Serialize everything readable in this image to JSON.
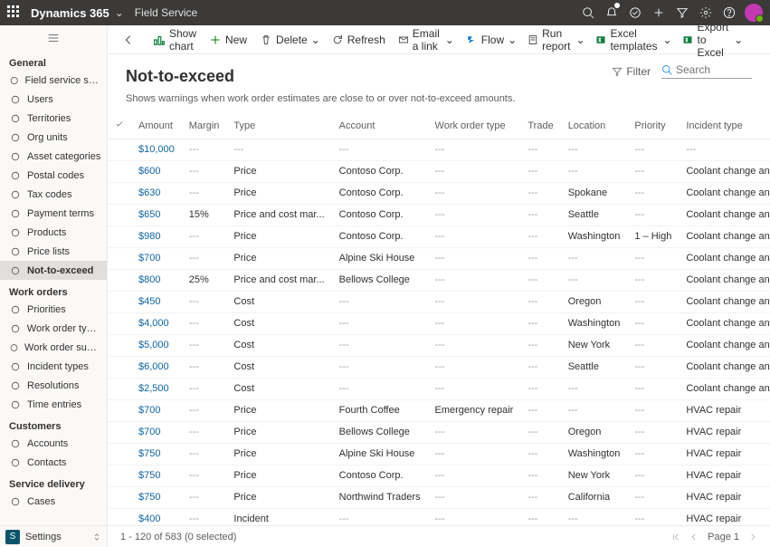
{
  "topbar": {
    "brand": "Dynamics 365",
    "area": "Field Service"
  },
  "sidebar": {
    "sections": [
      {
        "title": "General",
        "items": [
          {
            "label": "Field service settings",
            "icon": "gear",
            "key": "fss"
          },
          {
            "label": "Users",
            "icon": "user",
            "key": "users"
          },
          {
            "label": "Territories",
            "icon": "globe",
            "key": "terr"
          },
          {
            "label": "Org units",
            "icon": "org",
            "key": "org"
          },
          {
            "label": "Asset categories",
            "icon": "tag",
            "key": "assetcat"
          },
          {
            "label": "Postal codes",
            "icon": "mail",
            "key": "postal"
          },
          {
            "label": "Tax codes",
            "icon": "doc",
            "key": "tax"
          },
          {
            "label": "Payment terms",
            "icon": "card",
            "key": "payterms"
          },
          {
            "label": "Products",
            "icon": "box",
            "key": "prod"
          },
          {
            "label": "Price lists",
            "icon": "list",
            "key": "pricelists"
          },
          {
            "label": "Not-to-exceed",
            "icon": "nte",
            "key": "nte",
            "active": true
          }
        ]
      },
      {
        "title": "Work orders",
        "items": [
          {
            "label": "Priorities",
            "icon": "prio",
            "key": "prio"
          },
          {
            "label": "Work order types",
            "icon": "wot",
            "key": "wot"
          },
          {
            "label": "Work order substatu...",
            "icon": "wos",
            "key": "wos"
          },
          {
            "label": "Incident types",
            "icon": "incident",
            "key": "inct"
          },
          {
            "label": "Resolutions",
            "icon": "check",
            "key": "res"
          },
          {
            "label": "Time entries",
            "icon": "clock",
            "key": "time"
          }
        ]
      },
      {
        "title": "Customers",
        "items": [
          {
            "label": "Accounts",
            "icon": "building",
            "key": "acct"
          },
          {
            "label": "Contacts",
            "icon": "contact",
            "key": "cont"
          }
        ]
      },
      {
        "title": "Service delivery",
        "items": [
          {
            "label": "Cases",
            "icon": "case",
            "key": "cases"
          }
        ]
      }
    ],
    "settings_label": "Settings",
    "settings_badge": "S"
  },
  "commands": {
    "back": "Back",
    "show_chart": "Show chart",
    "new": "New",
    "delete": "Delete",
    "refresh": "Refresh",
    "email_link": "Email a link",
    "flow": "Flow",
    "run_report": "Run report",
    "excel_templates": "Excel templates",
    "export_excel": "Export to Excel"
  },
  "page": {
    "title": "Not-to-exceed",
    "description": "Shows warnings when work order estimates are close to or over not-to-exceed amounts.",
    "filter_label": "Filter",
    "search_placeholder": "Search"
  },
  "grid": {
    "columns": [
      "Amount",
      "Margin",
      "Type",
      "Account",
      "Work order type",
      "Trade",
      "Location",
      "Priority",
      "Incident type"
    ],
    "rows": [
      {
        "amount": "$10,000",
        "margin": "---",
        "type": "---",
        "account": "---",
        "wot": "---",
        "trade": "---",
        "location": "---",
        "priority": "---",
        "incident": "---"
      },
      {
        "amount": "$600",
        "margin": "---",
        "type": "Price",
        "account": "Contoso Corp.",
        "wot": "---",
        "trade": "---",
        "location": "---",
        "priority": "---",
        "incident": "Coolant change and disposal"
      },
      {
        "amount": "$630",
        "margin": "---",
        "type": "Price",
        "account": "Contoso Corp.",
        "wot": "---",
        "trade": "---",
        "location": "Spokane",
        "priority": "---",
        "incident": "Coolant change and disposal"
      },
      {
        "amount": "$650",
        "margin": "15%",
        "type": "Price and cost mar...",
        "account": "Contoso Corp.",
        "wot": "---",
        "trade": "---",
        "location": "Seattle",
        "priority": "---",
        "incident": "Coolant change and disposal"
      },
      {
        "amount": "$980",
        "margin": "---",
        "type": "Price",
        "account": "Contoso Corp.",
        "wot": "---",
        "trade": "---",
        "location": "Washington",
        "priority": "1 – High",
        "incident": "Coolant change and disposal"
      },
      {
        "amount": "$700",
        "margin": "---",
        "type": "Price",
        "account": "Alpine Ski House",
        "wot": "---",
        "trade": "---",
        "location": "---",
        "priority": "---",
        "incident": "Coolant change and disposal"
      },
      {
        "amount": "$800",
        "margin": "25%",
        "type": "Price and cost mar...",
        "account": "Bellows College",
        "wot": "---",
        "trade": "---",
        "location": "---",
        "priority": "---",
        "incident": "Coolant change and disposal"
      },
      {
        "amount": "$450",
        "margin": "---",
        "type": "Cost",
        "account": "---",
        "wot": "---",
        "trade": "---",
        "location": "Oregon",
        "priority": "---",
        "incident": "Coolant change and disposal"
      },
      {
        "amount": "$4,000",
        "margin": "---",
        "type": "Cost",
        "account": "---",
        "wot": "---",
        "trade": "---",
        "location": "Washington",
        "priority": "---",
        "incident": "Coolant change and disposal"
      },
      {
        "amount": "$5,000",
        "margin": "---",
        "type": "Cost",
        "account": "---",
        "wot": "---",
        "trade": "---",
        "location": "New York",
        "priority": "---",
        "incident": "Coolant change and disposal"
      },
      {
        "amount": "$6,000",
        "margin": "---",
        "type": "Cost",
        "account": "---",
        "wot": "---",
        "trade": "---",
        "location": "Seattle",
        "priority": "---",
        "incident": "Coolant change and disposal"
      },
      {
        "amount": "$2,500",
        "margin": "---",
        "type": "Cost",
        "account": "---",
        "wot": "---",
        "trade": "---",
        "location": "---",
        "priority": "---",
        "incident": "Coolant change and disposal"
      },
      {
        "amount": "$700",
        "margin": "---",
        "type": "Price",
        "account": "Fourth Coffee",
        "wot": "Emergency repair",
        "trade": "---",
        "location": "---",
        "priority": "---",
        "incident": "HVAC repair"
      },
      {
        "amount": "$700",
        "margin": "---",
        "type": "Price",
        "account": "Bellows College",
        "wot": "---",
        "trade": "---",
        "location": "Oregon",
        "priority": "---",
        "incident": "HVAC repair"
      },
      {
        "amount": "$750",
        "margin": "---",
        "type": "Price",
        "account": "Alpine Ski House",
        "wot": "---",
        "trade": "---",
        "location": "Washington",
        "priority": "---",
        "incident": "HVAC repair"
      },
      {
        "amount": "$750",
        "margin": "---",
        "type": "Price",
        "account": "Contoso Corp.",
        "wot": "---",
        "trade": "---",
        "location": "New York",
        "priority": "---",
        "incident": "HVAC repair"
      },
      {
        "amount": "$750",
        "margin": "---",
        "type": "Price",
        "account": "Northwind Traders",
        "wot": "---",
        "trade": "---",
        "location": "California",
        "priority": "---",
        "incident": "HVAC repair"
      },
      {
        "amount": "$400",
        "margin": "---",
        "type": "Incident",
        "account": "---",
        "wot": "---",
        "trade": "---",
        "location": "---",
        "priority": "---",
        "incident": "HVAC repair"
      }
    ],
    "footer_count": "1 - 120 of 583 (0 selected)",
    "page_label": "Page 1"
  }
}
